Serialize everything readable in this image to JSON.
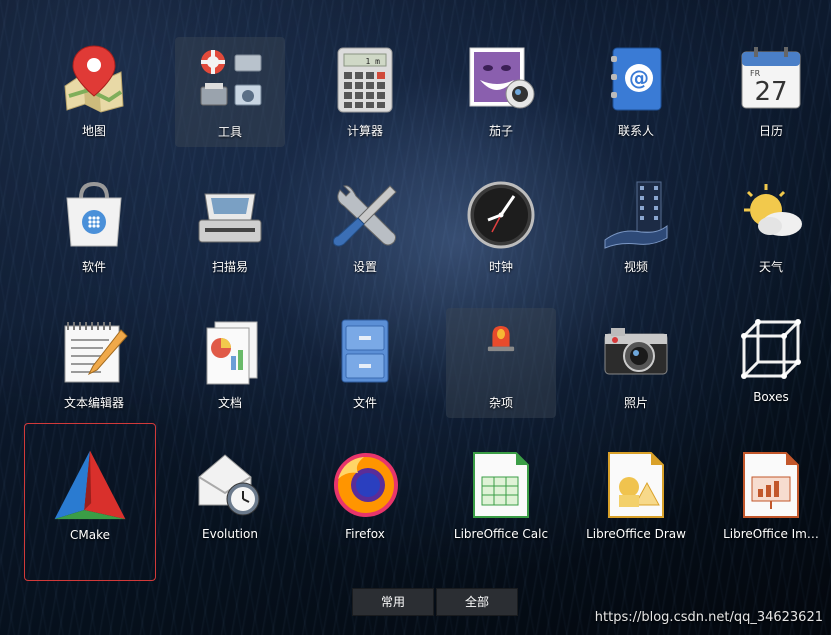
{
  "apps": [
    {
      "label": "地图",
      "icon": "map-icon"
    },
    {
      "label": "工具",
      "icon": "utilities-folder-icon"
    },
    {
      "label": "计算器",
      "icon": "calculator-icon"
    },
    {
      "label": "茄子",
      "icon": "cheese-webcam-icon"
    },
    {
      "label": "联系人",
      "icon": "contacts-icon"
    },
    {
      "label": "日历",
      "icon": "calendar-icon",
      "day": "27",
      "weekday": "FR"
    },
    {
      "label": "软件",
      "icon": "software-bag-icon"
    },
    {
      "label": "扫描易",
      "icon": "scanner-icon"
    },
    {
      "label": "设置",
      "icon": "settings-tools-icon"
    },
    {
      "label": "时钟",
      "icon": "clock-icon"
    },
    {
      "label": "视频",
      "icon": "video-film-icon"
    },
    {
      "label": "天气",
      "icon": "weather-icon"
    },
    {
      "label": "文本编辑器",
      "icon": "text-editor-icon"
    },
    {
      "label": "文档",
      "icon": "documents-icon"
    },
    {
      "label": "文件",
      "icon": "file-cabinet-icon"
    },
    {
      "label": "杂项",
      "icon": "sundry-folder-icon"
    },
    {
      "label": "照片",
      "icon": "camera-icon"
    },
    {
      "label": "Boxes",
      "icon": "boxes-icon"
    },
    {
      "label": "CMake",
      "icon": "cmake-icon"
    },
    {
      "label": "Evolution",
      "icon": "evolution-mail-icon"
    },
    {
      "label": "Firefox",
      "icon": "firefox-icon"
    },
    {
      "label": "LibreOffice Calc",
      "icon": "libreoffice-calc-icon"
    },
    {
      "label": "LibreOffice Draw",
      "icon": "libreoffice-draw-icon"
    },
    {
      "label": "LibreOffice Im…",
      "icon": "libreoffice-impress-icon"
    }
  ],
  "calculator_display": "1 m",
  "tabs": [
    {
      "label": "常用"
    },
    {
      "label": "全部"
    }
  ],
  "watermark": "https://blog.csdn.net/qq_34623621",
  "colors": {
    "selection_border": "#d23a3a",
    "folder_bg": "#3c4655",
    "tab_bg": "#2b2e33"
  }
}
